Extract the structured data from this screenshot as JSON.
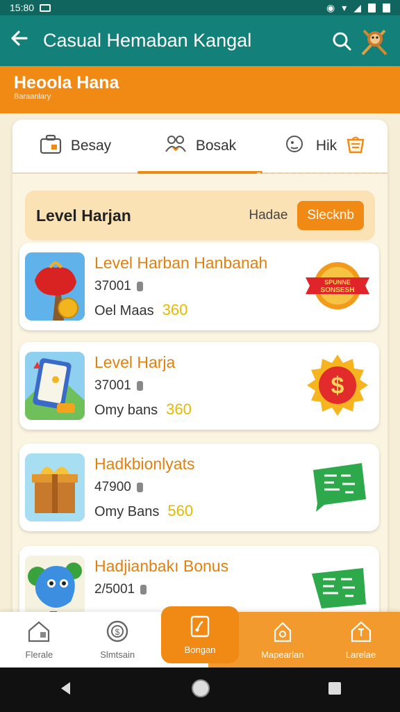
{
  "status": {
    "time": "15:80"
  },
  "appbar": {
    "title": "Casual Hemaban Kangal"
  },
  "promo": {
    "title": "Heoola Hana",
    "subtitle": "Baraanlary"
  },
  "tabs": [
    {
      "label": "Besay",
      "icon": "briefcase-icon"
    },
    {
      "label": "Bosak",
      "icon": "people-icon"
    },
    {
      "label": "Hik",
      "icon": "headset-icon"
    }
  ],
  "level": {
    "title": "Level Harjan",
    "link": "Hadae",
    "button": "Slecknb"
  },
  "cards": [
    {
      "title": "Level Harban Hanbanah",
      "count": "37001",
      "reward_label": "Oel Maas",
      "amount": "360",
      "badge_text": "SPUNNE SONSESH",
      "icon": "treasure-bag-icon",
      "badge_icon": "ribbon-badge-icon"
    },
    {
      "title": "Level Harja",
      "count": "37001",
      "reward_label": "Omy bans",
      "amount": "360",
      "badge_text": "$",
      "icon": "tablet-icon",
      "badge_icon": "dollar-badge-icon"
    },
    {
      "title": "Hadkbionlyats",
      "count": "47900",
      "reward_label": "Omy Bans",
      "amount": "560",
      "badge_text": "",
      "icon": "gift-box-icon",
      "badge_icon": "green-tag-icon"
    },
    {
      "title": "Hadjianbakı Bonus",
      "count": "2/5001",
      "reward_label": "",
      "amount": "",
      "badge_text": "",
      "icon": "blue-monster-icon",
      "badge_icon": "green-tag-icon"
    }
  ],
  "bottom_nav": [
    {
      "label": "Flerale",
      "icon": "home-icon"
    },
    {
      "label": "Slmtsain",
      "icon": "coin-icon"
    },
    {
      "label": "Bongan",
      "icon": "note-icon"
    },
    {
      "label": "Mapearlan",
      "icon": "lock-icon"
    },
    {
      "label": "Larelae",
      "icon": "house-icon"
    }
  ],
  "colors": {
    "teal": "#14807a",
    "orange": "#f08a14",
    "gold": "#e5b900"
  }
}
